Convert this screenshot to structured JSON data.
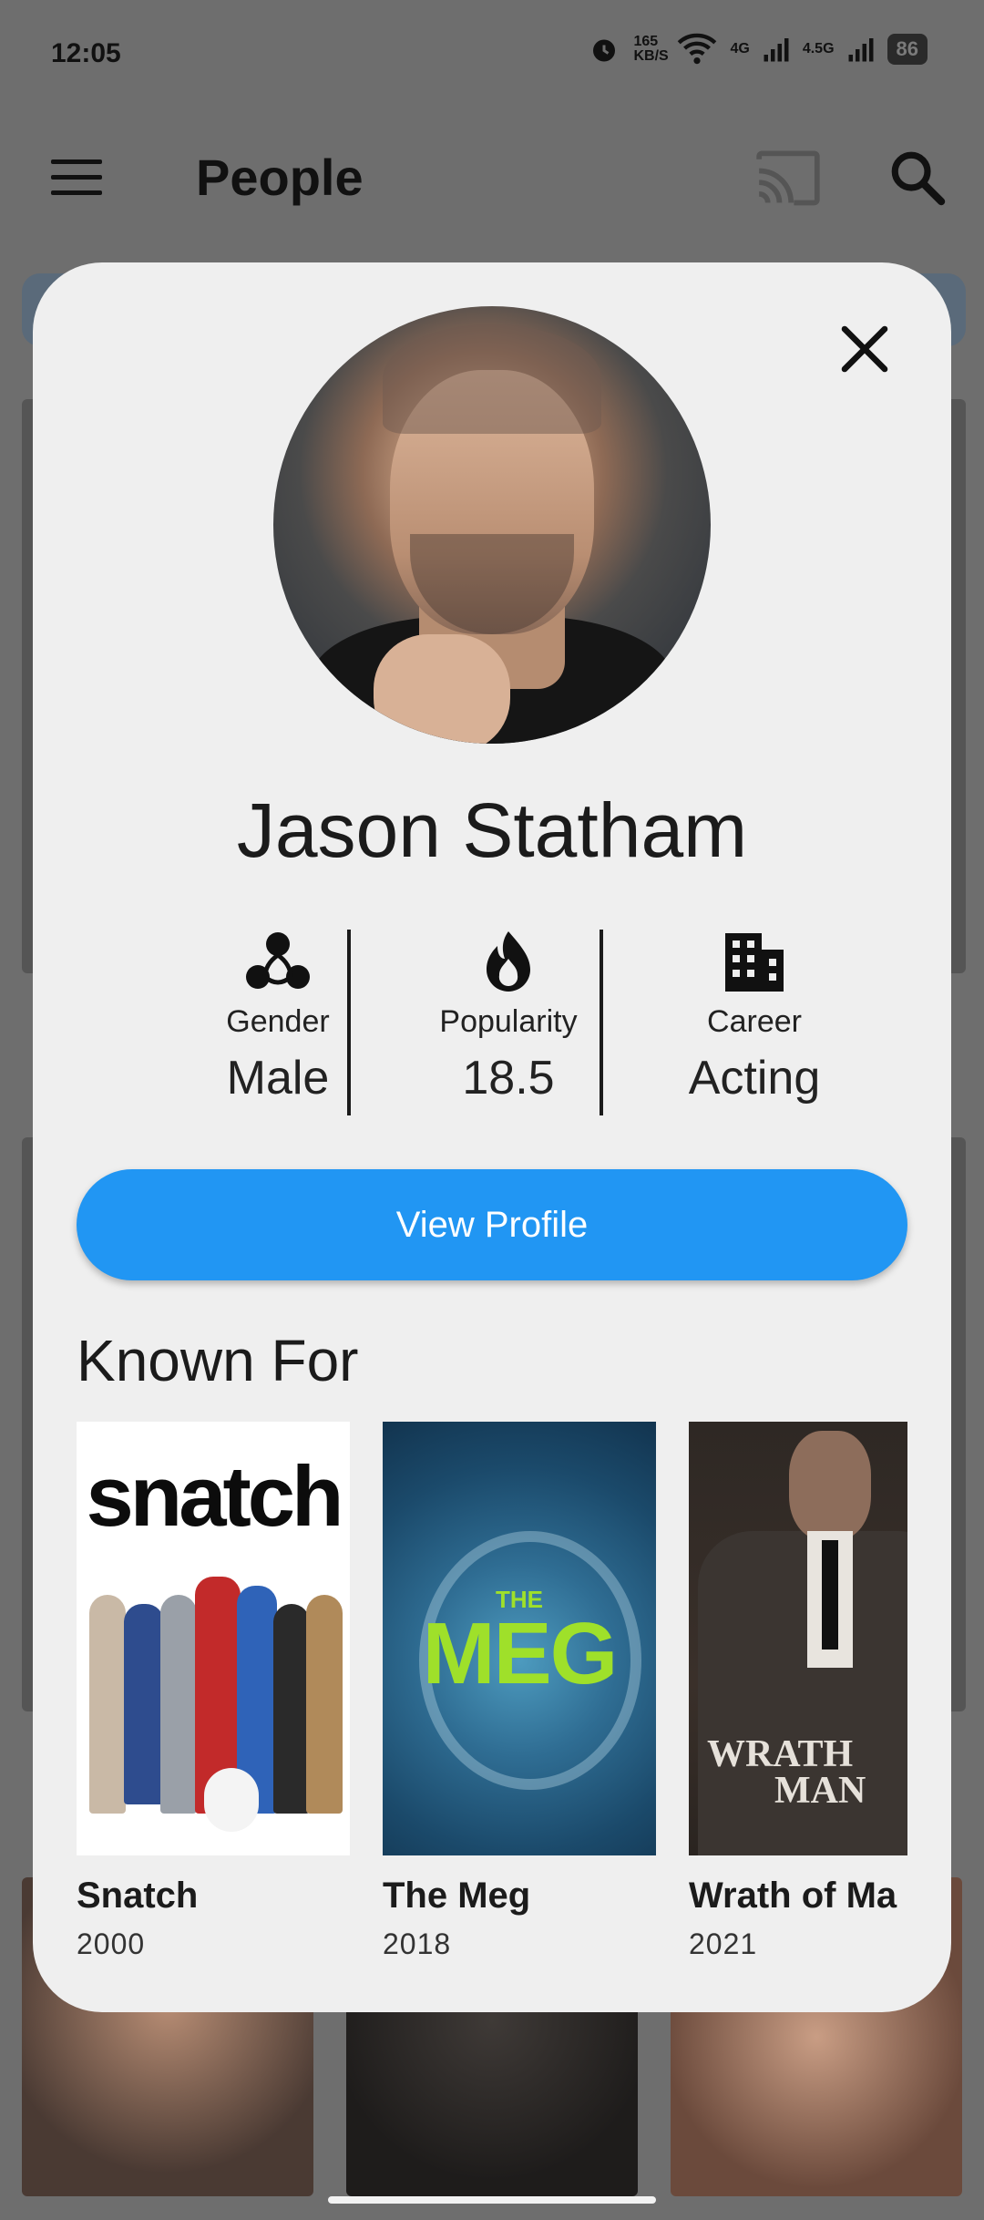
{
  "status_bar": {
    "time": "12:05",
    "network_speed": "165 KB/S",
    "signal1": "4G",
    "signal2": "4.5G",
    "battery": "86"
  },
  "app_bar": {
    "title": "People"
  },
  "dialog": {
    "name": "Jason Statham",
    "stats": [
      {
        "label": "Gender",
        "value": "Male",
        "icon": "gender-icon"
      },
      {
        "label": "Popularity",
        "value": "18.5",
        "icon": "flame-icon"
      },
      {
        "label": "Career",
        "value": "Acting",
        "icon": "building-icon"
      }
    ],
    "view_profile_label": "View Profile",
    "known_for_title": "Known For",
    "known_for": [
      {
        "title": "Snatch",
        "year": "2000",
        "poster_text": "snatch"
      },
      {
        "title": "The Meg",
        "year": "2018",
        "poster_text": "MEG",
        "poster_small": "THE"
      },
      {
        "title": "Wrath of Ma",
        "year": "2021",
        "poster_text": "WRATH",
        "poster_text2": "MAN"
      }
    ]
  },
  "colors": {
    "accent": "#2196f3",
    "scrim": "#6e6e6e",
    "dialog_bg": "#efefef"
  }
}
